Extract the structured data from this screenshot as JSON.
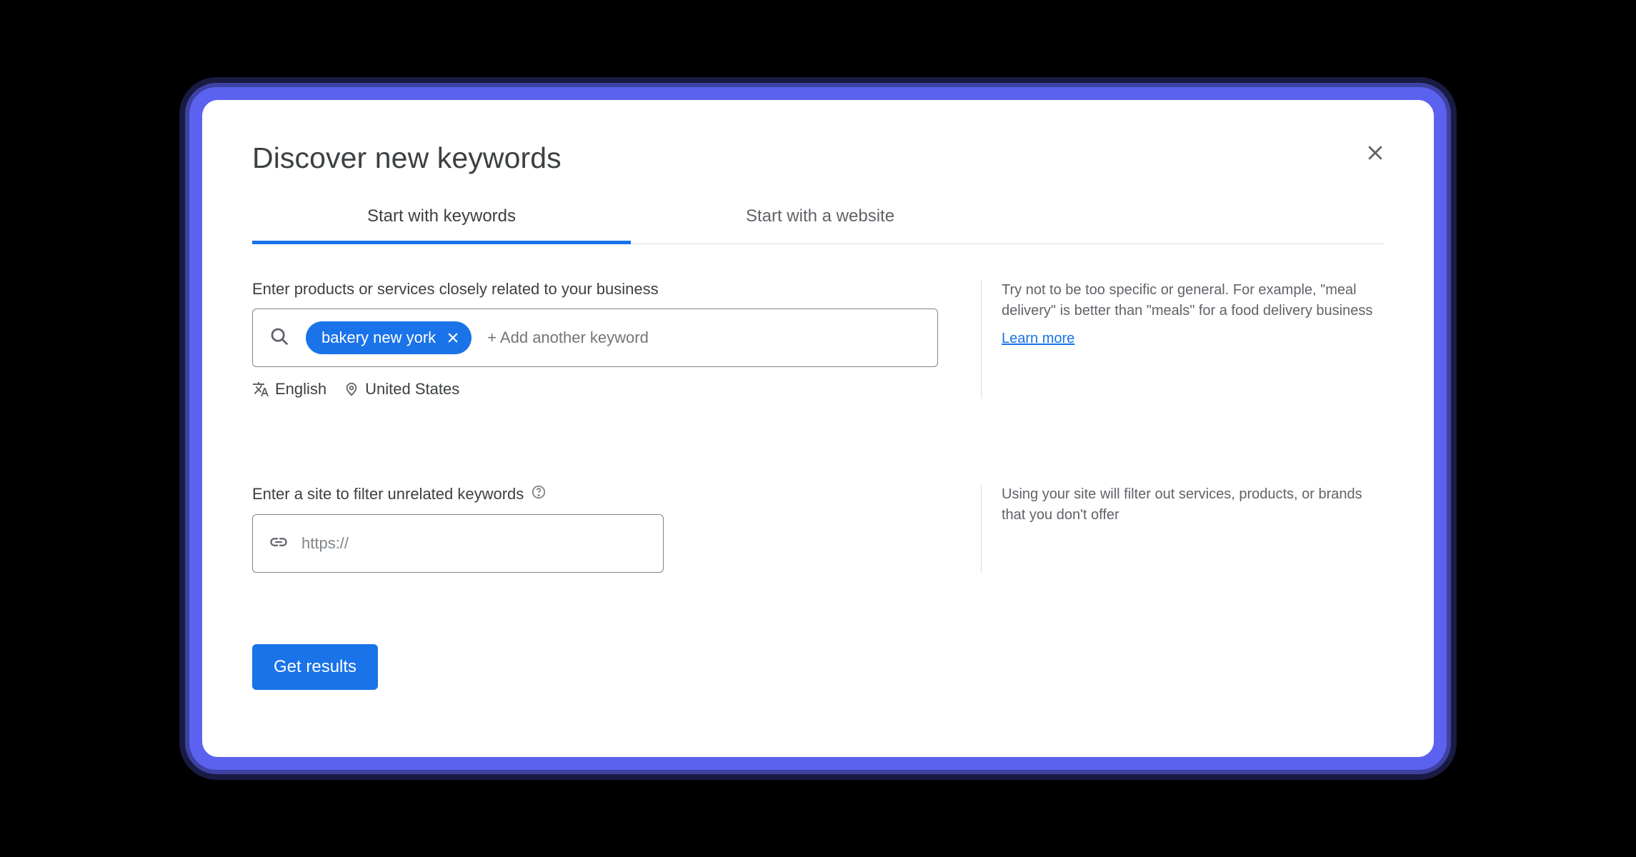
{
  "title": "Discover new keywords",
  "tabs": {
    "keywords": "Start with keywords",
    "website": "Start with a website"
  },
  "section1": {
    "label": "Enter products or services closely related to your business",
    "chip": "bakery new york",
    "add_placeholder": "+ Add another keyword",
    "language": "English",
    "location": "United States",
    "tip": "Try not to be too specific or general. For example, \"meal delivery\" is better than \"meals\" for a food delivery business",
    "learn_more": "Learn more"
  },
  "section2": {
    "label": "Enter a site to filter unrelated keywords",
    "url_placeholder": "https://",
    "tip": "Using your site will filter out services, products, or brands that you don't offer"
  },
  "submit": "Get results"
}
